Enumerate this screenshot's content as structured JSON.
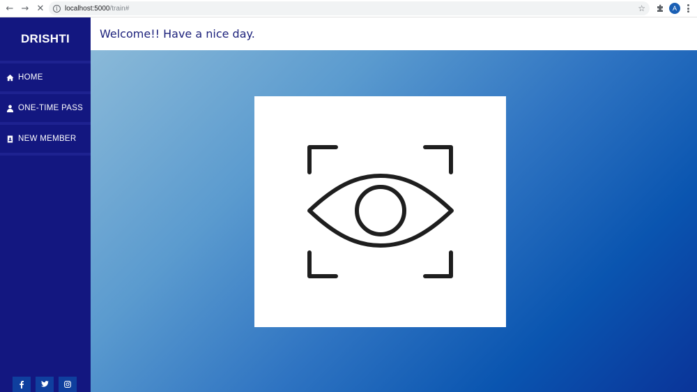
{
  "browser": {
    "url_host": "localhost:5000",
    "url_path": "/train#",
    "avatar_letter": "A",
    "nav_icons": [
      "back-icon",
      "forward-icon",
      "stop-loading-icon"
    ]
  },
  "sidebar": {
    "brand": "DRISHTI",
    "items": [
      {
        "label": "HOME",
        "icon": "home-icon"
      },
      {
        "label": "ONE-TIME PASS",
        "icon": "user-icon"
      },
      {
        "label": "NEW MEMBER",
        "icon": "address-book-icon"
      }
    ],
    "socials": [
      {
        "label": "f",
        "icon": "facebook-icon"
      },
      {
        "label": "t",
        "icon": "twitter-icon"
      },
      {
        "label": "ig",
        "icon": "instagram-icon"
      }
    ]
  },
  "header": {
    "welcome": "Welcome!! Have a nice day."
  },
  "main": {
    "card_icon": "eye-scan-icon"
  },
  "colors": {
    "sidebar_bg": "#131780",
    "title_color": "#1a1f7a",
    "gradient_start": "#8ab9d8",
    "gradient_end": "#0a3499"
  }
}
